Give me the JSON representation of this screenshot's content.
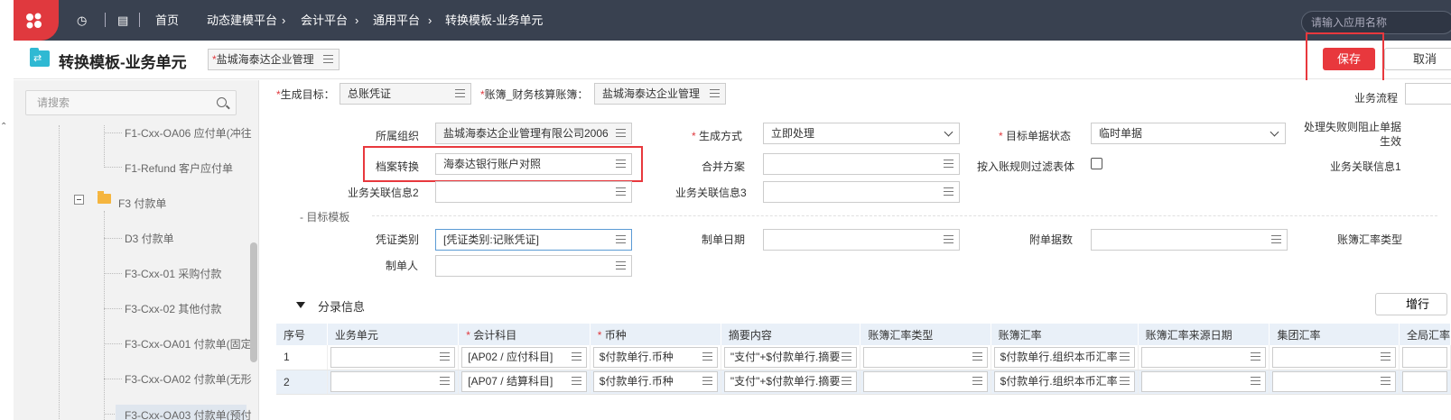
{
  "topbar": {
    "breadcrumbs": [
      "首页",
      "动态建模平台",
      "会计平台",
      "通用平台",
      "转换模板-业务单元"
    ],
    "app_search_placeholder": "请输入应用名称"
  },
  "header": {
    "title": "转换模板-业务单元",
    "org_value": "盐城海泰达企业管理",
    "save_label": "保存",
    "cancel_label": "取消"
  },
  "sidebar": {
    "search_placeholder": "请搜索",
    "items": [
      "F1-Cxx-OA06 应付单(冲往",
      "F1-Refund 客户应付单",
      "F3 付款单",
      "D3 付款单",
      "F3-Cxx-01 采购付款",
      "F3-Cxx-02 其他付款",
      "F3-Cxx-OA01 付款单(固定",
      "F3-Cxx-OA02 付款单(无形",
      "F3-Cxx-OA03 付款单(预付"
    ]
  },
  "form": {
    "gen_target_label": "生成目标：",
    "gen_target_value": "总账凭证",
    "ledger_label": "账簿_财务核算账簿：",
    "ledger_value": "盐城海泰达企业管理",
    "biz_flow_label": "业务流程",
    "org_label": "所属组织",
    "org_value": "盐城海泰达企业管理有限公司2006",
    "gen_mode_label": "生成方式",
    "gen_mode_value": "立即处理",
    "target_status_label": "目标单据状态",
    "target_status_value": "临时单据",
    "fail_block_label": "处理失败则阻止单据生效",
    "archive_label": "档案转换",
    "archive_value": "海泰达银行账户对照",
    "merge_label": "合并方案",
    "merge_value": "",
    "filter_label": "按入账规则过滤表体",
    "biz_info1_label": "业务关联信息1",
    "biz_info2_label": "业务关联信息2",
    "biz_info3_label": "业务关联信息3",
    "target_template_label": "- 目标模板",
    "voucher_type_label": "凭证类别",
    "voucher_type_value": "[凭证类别:记账凭证]",
    "make_date_label": "制单日期",
    "attach_count_label": "附单据数",
    "ledger_rate_type_label": "账簿汇率类型",
    "maker_label": "制单人"
  },
  "entries": {
    "title": "分录信息",
    "add_row_label": "增行",
    "columns": [
      "序号",
      "业务单元",
      "会计科目",
      "币种",
      "摘要内容",
      "账簿汇率类型",
      "账簿汇率",
      "账簿汇率来源日期",
      "集团汇率",
      "全局汇率"
    ],
    "required_columns": [
      "会计科目",
      "币种"
    ],
    "rows": [
      [
        "1",
        "",
        "[AP02 / 应付科目]",
        "$付款单行.币种",
        "\"支付\"+$付款单行.摘要",
        "",
        "$付款单行.组织本币汇率",
        "",
        "",
        ""
      ],
      [
        "2",
        "",
        "[AP07 / 结算科目]",
        "$付款单行.币种",
        "\"支付\"+$付款单行.摘要",
        "",
        "$付款单行.组织本币汇率",
        "",
        "",
        ""
      ]
    ]
  },
  "colors": {
    "accent_red": "#e8383d",
    "topbar_bg": "#394150",
    "header_row_bg": "#e9f0f8"
  }
}
